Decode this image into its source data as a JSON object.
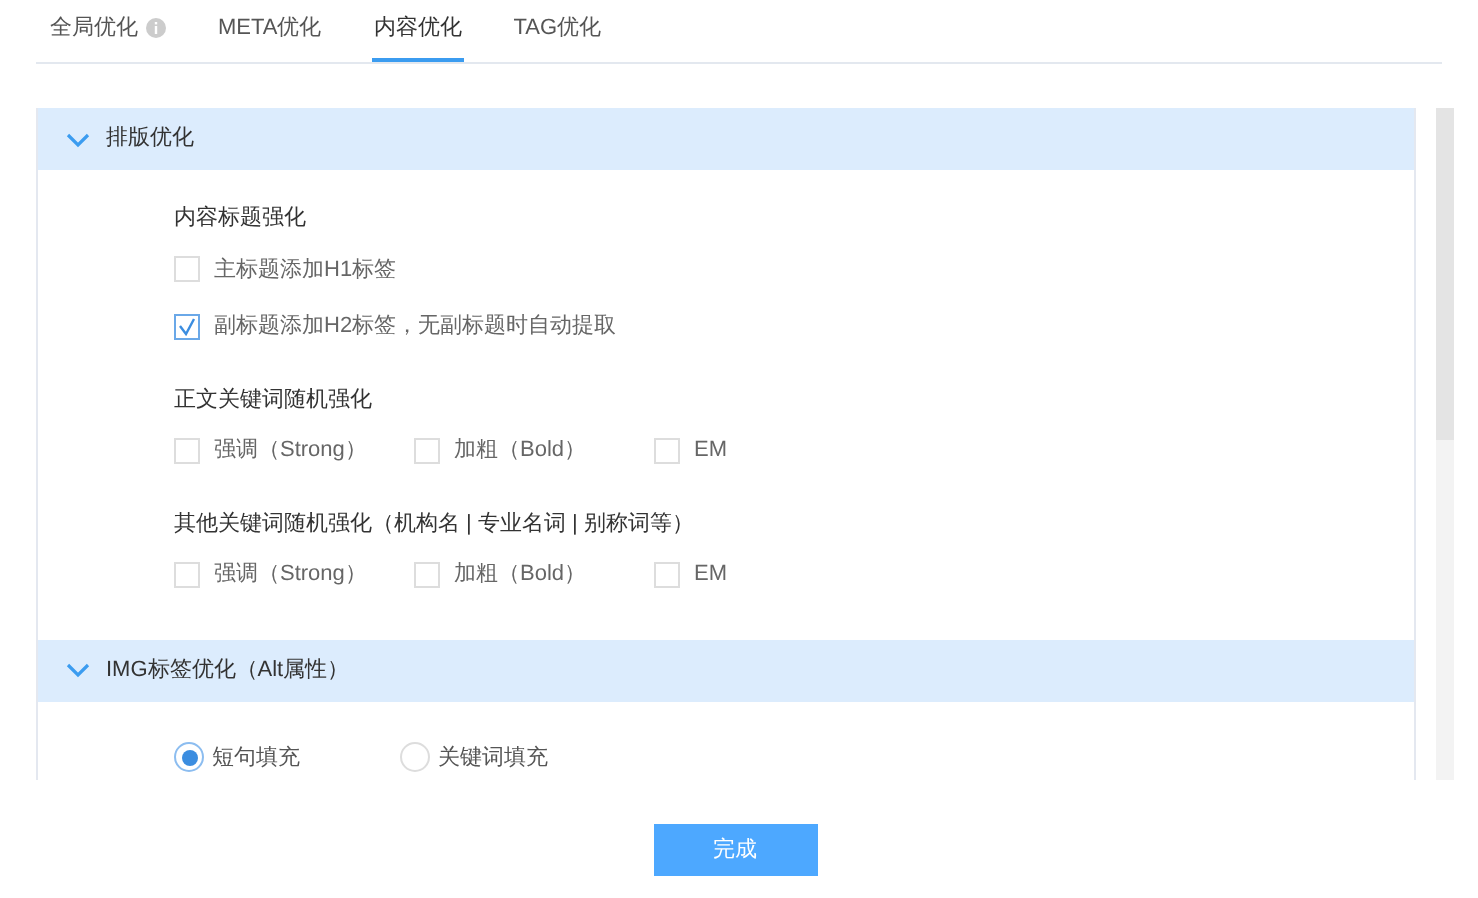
{
  "tabs": [
    {
      "label": "全局优化",
      "selected": false,
      "info": true
    },
    {
      "label": "META优化",
      "selected": false,
      "info": false
    },
    {
      "label": "内容优化",
      "selected": true,
      "info": false
    },
    {
      "label": "TAG优化",
      "selected": false,
      "info": false
    }
  ],
  "sections": [
    {
      "kind": "checkbox_groups",
      "title": "排版优化",
      "expanded": true,
      "groups": [
        {
          "title": "内容标题强化",
          "kind": "stack",
          "options": [
            {
              "label": "主标题添加H1标签",
              "checked": false
            },
            {
              "label": "副标题添加H2标签，无副标题时自动提取",
              "checked": true
            }
          ]
        },
        {
          "title": "正文关键词随机强化",
          "kind": "row",
          "options": [
            {
              "label": "强调（Strong）",
              "checked": false
            },
            {
              "label": "加粗（Bold）",
              "checked": false
            },
            {
              "label": "EM",
              "checked": false
            }
          ]
        },
        {
          "title": "其他关键词随机强化（机构名 | 专业名词 | 别称词等）",
          "kind": "row",
          "options": [
            {
              "label": "强调（Strong）",
              "checked": false
            },
            {
              "label": "加粗（Bold）",
              "checked": false
            },
            {
              "label": "EM",
              "checked": false
            }
          ]
        }
      ]
    },
    {
      "kind": "radio",
      "title": "IMG标签优化（Alt属性）",
      "expanded": true,
      "options": [
        {
          "label": "短句填充",
          "selected": true
        },
        {
          "label": "关键词填充",
          "selected": false
        }
      ]
    }
  ],
  "done_button": "完成"
}
